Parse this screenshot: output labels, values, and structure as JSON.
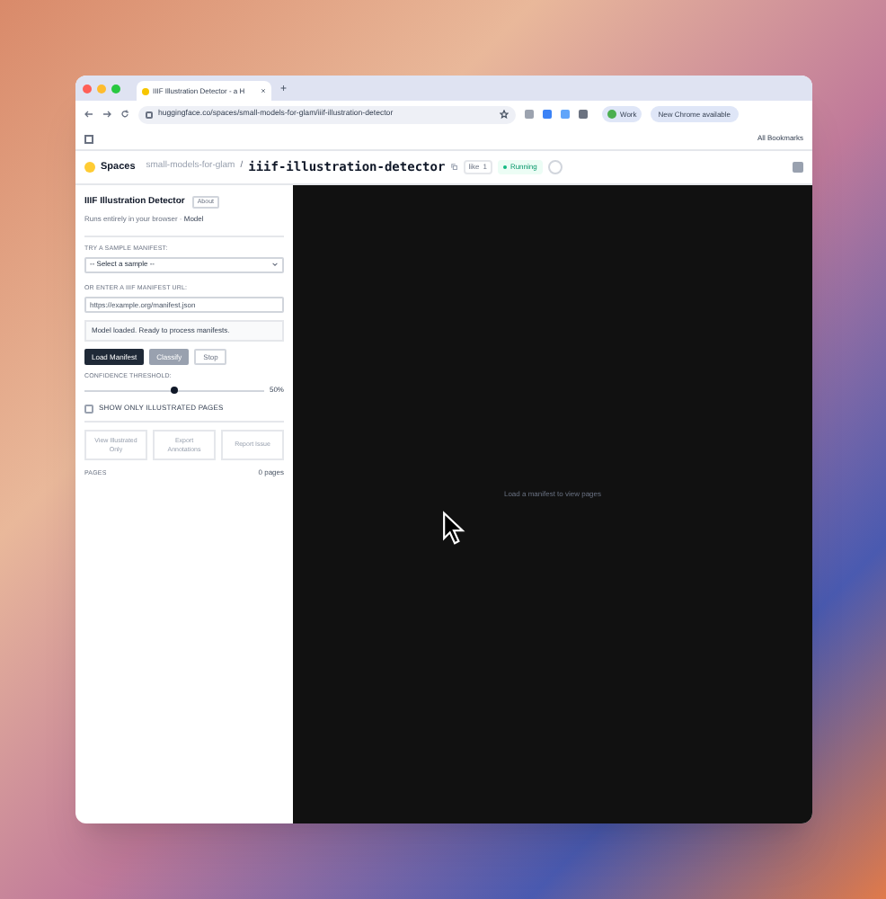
{
  "browser": {
    "tab_title": "IIIF Illustration Detector - a H",
    "new_tab": "+",
    "url": "huggingface.co/spaces/small-models-for-glam/iiif-illustration-detector",
    "profile": "Work",
    "update_button": "New Chrome available",
    "bookmarks": "All Bookmarks"
  },
  "space_header": {
    "brand": "Spaces",
    "owner": "small-models-for-glam",
    "separator": "/",
    "repo": "iiif-illustration-detector",
    "like": "like",
    "like_count": "1",
    "status": "Running"
  },
  "sidebar": {
    "title": "IIIF Illustration Detector",
    "about": "About",
    "subtitle": "Runs entirely in your browser · ",
    "model_link": "Model",
    "sample_label": "TRY A SAMPLE MANIFEST:",
    "sample_select": "-- Select a sample --",
    "url_label": "OR ENTER A IIIF MANIFEST URL:",
    "url_placeholder": "https://example.org/manifest.json",
    "status_message": "Model loaded. Ready to process manifests.",
    "actions": [
      {
        "label": "Load Manifest",
        "disabled": false
      },
      {
        "label": "Classify",
        "disabled": true
      },
      {
        "label": "Stop",
        "disabled": true
      }
    ],
    "threshold_label": "CONFIDENCE THRESHOLD:",
    "threshold": {
      "level": 0.5
    },
    "threshold_reading": "50%",
    "filter": {
      "label": "SHOW ONLY ILLUSTRATED PAGES",
      "checked": false
    },
    "tools": [
      {
        "label": "View Illustrated Only",
        "disabled": true
      },
      {
        "label": "Export Annotations",
        "disabled": true
      },
      {
        "label": "Report Issue",
        "disabled": true
      }
    ],
    "pages_label": "PAGES",
    "pages_count": "0 pages"
  },
  "viewer": {
    "empty_message": "Load a manifest to view pages"
  }
}
